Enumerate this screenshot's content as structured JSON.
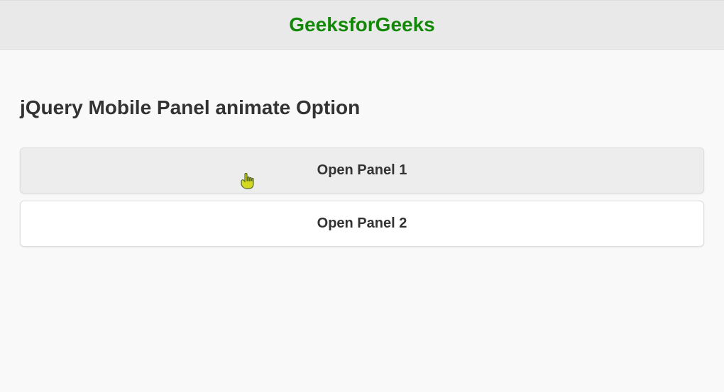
{
  "header": {
    "title": "GeeksforGeeks"
  },
  "content": {
    "heading": "jQuery Mobile Panel animate Option"
  },
  "buttons": {
    "panel1": "Open Panel 1",
    "panel2": "Open Panel 2"
  }
}
